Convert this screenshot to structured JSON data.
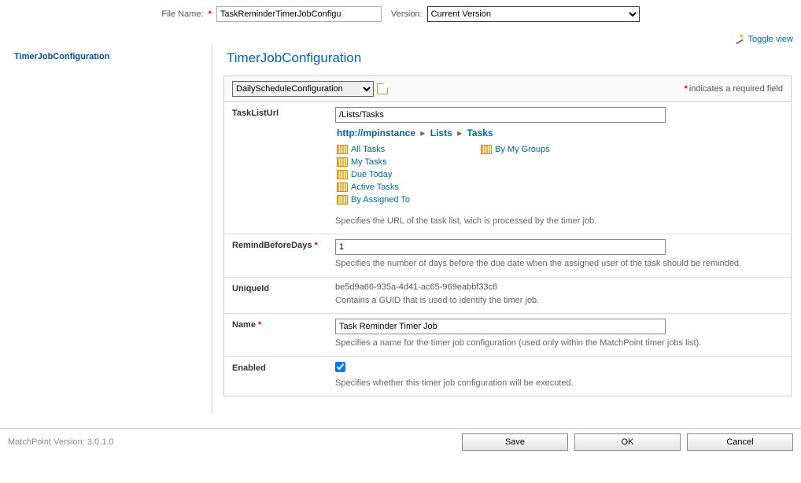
{
  "top": {
    "fileNameLabel": "File Name:",
    "fileName": "TaskReminderTimerJobConfigu",
    "versionLabel": "Version:",
    "versionSelected": "Current Version"
  },
  "toggle": {
    "label": "Toggle view"
  },
  "sidebar": {
    "link": "TimerJobConfiguration"
  },
  "page": {
    "title": "TimerJobConfiguration"
  },
  "configBar": {
    "typeSelected": "DailyScheduleConfiguration",
    "requiredNote": "indicates a required field"
  },
  "fields": {
    "taskListUrl": {
      "label": "TaskListUrl",
      "value": "/Lists/Tasks",
      "breadcrumb": {
        "root": "http://mpinstance",
        "mid": "Lists",
        "leaf": "Tasks"
      },
      "viewsLeft": [
        "All Tasks",
        "My Tasks",
        "Due Today",
        "Active Tasks",
        "By Assigned To"
      ],
      "viewsRight": [
        "By My Groups"
      ],
      "desc": "Specifies the URL of the task list, wich is processed by the timer job."
    },
    "remindBeforeDays": {
      "label": "RemindBeforeDays",
      "value": "1",
      "desc": "Specifies the number of days before the due date when the assigned user of the task should be reminded."
    },
    "uniqueId": {
      "label": "UniqueId",
      "value": "be5d9a66-935a-4d41-ac65-969eabbf33c6",
      "desc": "Contains a GUID that is used to identify the timer job."
    },
    "name": {
      "label": "Name",
      "value": "Task Reminder Timer Job",
      "desc": "Specifies a name for the timer job configuration (used only within the MatchPoint timer jobs list)."
    },
    "enabled": {
      "label": "Enabled",
      "checked": true,
      "desc": "Specifies whether this timer job configuration will be executed."
    }
  },
  "footer": {
    "versionLabel": "MatchPoint Version: 3.0.1.0",
    "save": "Save",
    "ok": "OK",
    "cancel": "Cancel"
  }
}
